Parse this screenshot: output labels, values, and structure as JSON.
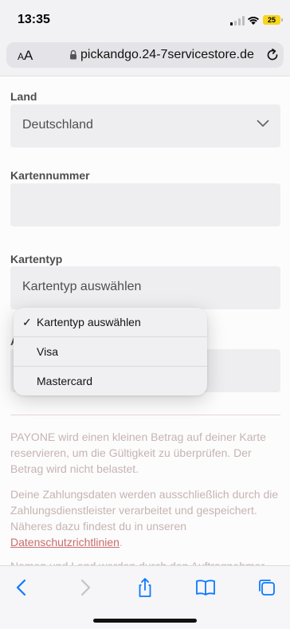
{
  "status_bar": {
    "time": "13:35",
    "battery": "25"
  },
  "browser": {
    "text_size_label": "AA",
    "url": "pickandgo.24-7servicestore.de"
  },
  "form": {
    "country": {
      "label": "Land",
      "value": "Deutschland"
    },
    "card_number": {
      "label": "Kartennummer",
      "value": ""
    },
    "card_type": {
      "label": "Kartentyp",
      "value": "Kartentyp auswählen"
    },
    "hidden_label_fragment": "A"
  },
  "picker": {
    "options": [
      "Kartentyp auswählen",
      "Visa",
      "Mastercard"
    ],
    "selected_index": 0
  },
  "notes": {
    "payone": "PAYONE wird einen kleinen Betrag auf deiner Karte reservieren, um die Gültigkeit zu überprüfen. Der Betrag wird nicht belastet.",
    "privacy_text": "Deine Zahlungsdaten werden ausschließlich durch die Zahlungsdienstleister verarbeitet und gespeichert. Näheres dazu findest du in unseren",
    "privacy_link": "Datenschutzrichtlinien",
    "privacy_end": ".",
    "cutoff": "Namen und Land werden durch den Auftragnehmer"
  },
  "colors": {
    "accent": "#0a7aff",
    "link": "#b73a3a",
    "note": "#b59a9a",
    "battery": "#f7d51d"
  },
  "toolbar": {
    "icons": [
      "back-icon",
      "forward-icon",
      "share-icon",
      "bookmarks-icon",
      "tabs-icon"
    ]
  }
}
